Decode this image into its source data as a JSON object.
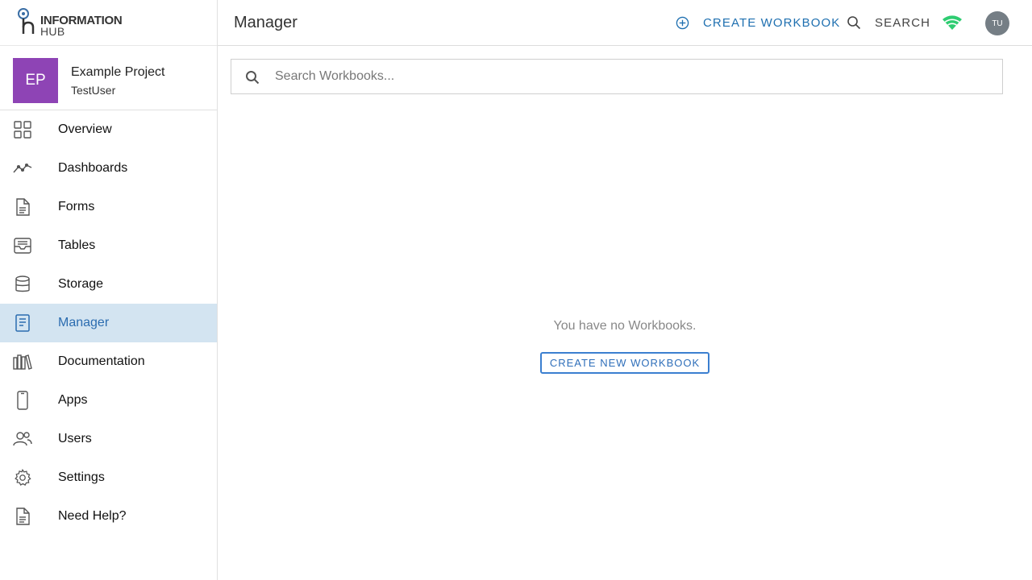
{
  "brand": {
    "line1": "INFORMATION",
    "line2": "HUB"
  },
  "project": {
    "initials": "EP",
    "name": "Example Project",
    "user": "TestUser",
    "badge_color": "#8e44b5"
  },
  "nav": {
    "items": [
      {
        "label": "Overview",
        "icon": "grid-icon"
      },
      {
        "label": "Dashboards",
        "icon": "line-chart-icon"
      },
      {
        "label": "Forms",
        "icon": "document-icon"
      },
      {
        "label": "Tables",
        "icon": "inbox-icon"
      },
      {
        "label": "Storage",
        "icon": "database-icon"
      },
      {
        "label": "Manager",
        "icon": "notebook-icon",
        "active": true
      },
      {
        "label": "Documentation",
        "icon": "books-icon"
      },
      {
        "label": "Apps",
        "icon": "phone-icon"
      },
      {
        "label": "Users",
        "icon": "users-icon"
      },
      {
        "label": "Settings",
        "icon": "gear-icon"
      },
      {
        "label": "Need Help?",
        "icon": "help-document-icon"
      }
    ]
  },
  "header": {
    "title": "Manager",
    "create_label": "CREATE WORKBOOK",
    "search_label": "SEARCH",
    "avatar_initials": "TU",
    "connection_color": "#2ecc71"
  },
  "search": {
    "placeholder": "Search Workbooks...",
    "value": ""
  },
  "empty_state": {
    "message": "You have no Workbooks.",
    "button_label": "CREATE NEW WORKBOOK"
  },
  "colors": {
    "accent": "#1e6fb0",
    "active_bg": "#d3e4f1"
  }
}
